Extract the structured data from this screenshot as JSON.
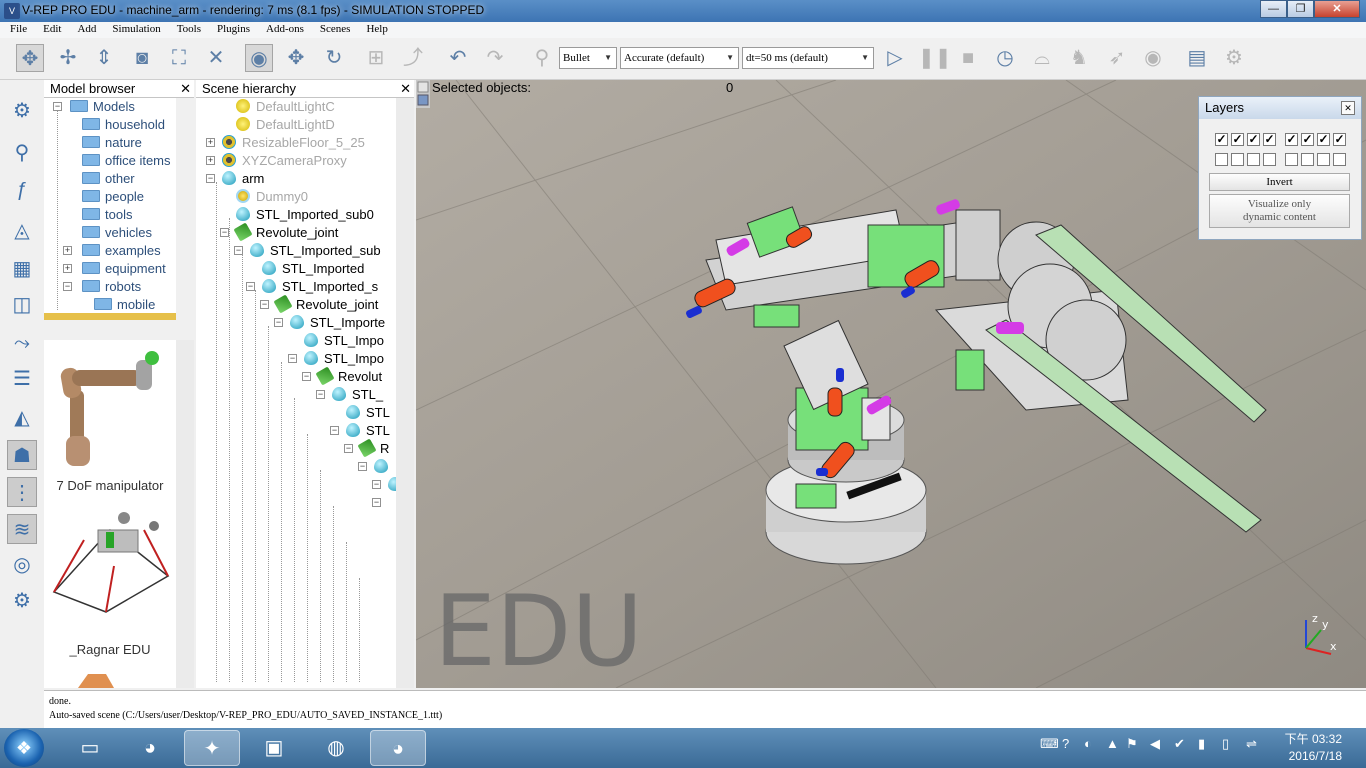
{
  "window": {
    "title": "V-REP PRO EDU - machine_arm - rendering: 7 ms (8.1 fps) - SIMULATION STOPPED",
    "app_icon": "V"
  },
  "window_controls": {
    "minimize": "—",
    "maximize": "❐",
    "close": "✕"
  },
  "menu": [
    "File",
    "Edit",
    "Add",
    "Simulation",
    "Tools",
    "Plugins",
    "Add-ons",
    "Scenes",
    "Help"
  ],
  "toolbar": {
    "engine": "Bullet",
    "accuracy": "Accurate (default)",
    "timestep": "dt=50 ms (default)"
  },
  "model_browser": {
    "title": "Model browser",
    "close": "✕",
    "tree": [
      {
        "label": "Models",
        "expander": "−"
      },
      {
        "label": "household"
      },
      {
        "label": "nature"
      },
      {
        "label": "office items"
      },
      {
        "label": "other"
      },
      {
        "label": "people"
      },
      {
        "label": "tools"
      },
      {
        "label": "vehicles"
      },
      {
        "label": "examples",
        "expander": "+"
      },
      {
        "label": "equipment",
        "expander": "+"
      },
      {
        "label": "robots",
        "expander": "−"
      },
      {
        "label": "mobile"
      }
    ],
    "previews": [
      {
        "caption": "7 DoF manipulator"
      },
      {
        "caption": "_Ragnar EDU"
      }
    ]
  },
  "scene_hierarchy": {
    "title": "Scene hierarchy",
    "close": "✕",
    "items": [
      {
        "label": "DefaultLightC",
        "icon": "light",
        "gray": true
      },
      {
        "label": "DefaultLightD",
        "icon": "light",
        "gray": true
      },
      {
        "label": "ResizableFloor_5_25",
        "icon": "cam",
        "gray": true,
        "expander": "+"
      },
      {
        "label": "XYZCameraProxy",
        "icon": "cam",
        "gray": true,
        "expander": "+"
      },
      {
        "label": "arm",
        "icon": "drop",
        "expander": "−"
      },
      {
        "label": "Dummy0",
        "icon": "dummy",
        "gray": true
      },
      {
        "label": "STL_Imported_sub0",
        "icon": "drop"
      },
      {
        "label": "Revolute_joint",
        "icon": "joint",
        "expander": "−"
      },
      {
        "label": "STL_Imported_sub",
        "icon": "drop",
        "expander": "−"
      },
      {
        "label": "STL_Imported",
        "icon": "drop"
      },
      {
        "label": "STL_Imported_s",
        "icon": "drop",
        "expander": "−"
      },
      {
        "label": "Revolute_joint",
        "icon": "joint",
        "expander": "−"
      },
      {
        "label": "STL_Importe",
        "icon": "drop",
        "expander": "−"
      },
      {
        "label": "STL_Impo",
        "icon": "drop"
      },
      {
        "label": "STL_Impo",
        "icon": "drop",
        "expander": "−"
      },
      {
        "label": "Revolut",
        "icon": "joint",
        "expander": "−"
      },
      {
        "label": "STL_",
        "icon": "drop",
        "expander": "−"
      },
      {
        "label": "STL",
        "icon": "drop"
      },
      {
        "label": "STL",
        "icon": "drop",
        "expander": "−"
      },
      {
        "label": "R",
        "icon": "joint",
        "expander": "−"
      },
      {
        "label": "",
        "icon": "drop",
        "expander": "−"
      },
      {
        "label": "",
        "icon": "drop",
        "expander": "−"
      },
      {
        "label": "",
        "icon": "none",
        "expander": "−"
      }
    ]
  },
  "viewport": {
    "selected_label": "Selected objects:",
    "selected_count": "0",
    "watermark": "EDU",
    "axes": {
      "x": "x",
      "y": "y",
      "z": "z"
    }
  },
  "layers": {
    "title": "Layers",
    "close": "✕",
    "row1_checked": [
      true,
      true,
      true,
      true,
      true,
      true,
      true,
      true
    ],
    "row2_checked": [
      false,
      false,
      false,
      false,
      false,
      false,
      false,
      false
    ],
    "invert": "Invert",
    "visualize_line1": "Visualize only",
    "visualize_line2": "dynamic content"
  },
  "status": {
    "line1": "done.",
    "line2": "Auto-saved scene (C:/Users/user/Desktop/V-REP_PRO_EDU/AUTO_SAVED_INSTANCE_1.ttt)"
  },
  "taskbar": {
    "clock_time": "下午 03:32",
    "clock_date": "2016/7/18"
  }
}
